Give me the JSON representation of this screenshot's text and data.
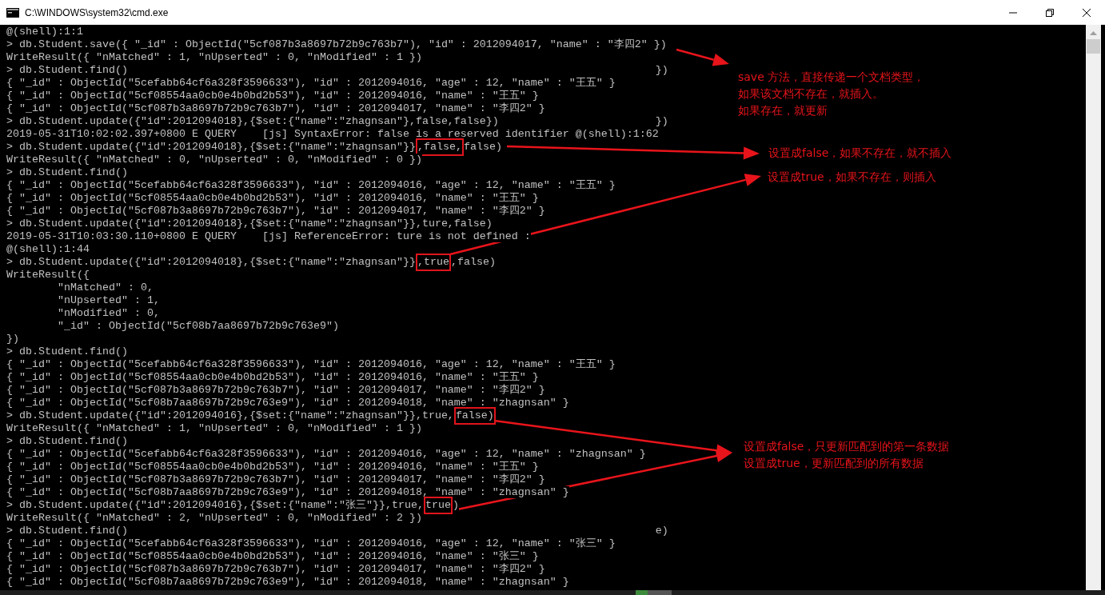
{
  "window": {
    "title": "C:\\WINDOWS\\system32\\cmd.exe"
  },
  "console": {
    "lines": [
      {
        "text": "@(shell):1:1"
      },
      {
        "text": "> db.Student.save({ \"_id\" : ObjectId(\"5cf087b3a8697b72b9c763b7\"), \"id\" : 2012094017, \"name\" : \"李四2\" })"
      },
      {
        "text": "WriteResult({ \"nMatched\" : 1, \"nUpserted\" : 0, \"nModified\" : 1 })"
      },
      {
        "text": "> db.Student.find()",
        "tail": "})"
      },
      {
        "text": "{ \"_id\" : ObjectId(\"5cefabb64cf6a328f3596633\"), \"id\" : 2012094016, \"age\" : 12, \"name\" : \"王五\" }"
      },
      {
        "text": "{ \"_id\" : ObjectId(\"5cf08554aa0cb0e4b0bd2b53\"), \"id\" : 2012094016, \"name\" : \"王五\" }"
      },
      {
        "text": "{ \"_id\" : ObjectId(\"5cf087b3a8697b72b9c763b7\"), \"id\" : 2012094017, \"name\" : \"李四2\" }"
      },
      {
        "text": "> db.Student.update({\"id\":2012094018},{$set:{\"name\":\"zhagnsan\"},false,false})",
        "tail": "})"
      },
      {
        "text": "2019-05-31T10:02:02.397+0800 E QUERY    [js] SyntaxError: false is a reserved identifier @(shell):1:62"
      },
      {
        "parts": [
          {
            "text": "> db.Student.update({\"id\":2012094018},{$set:{\"name\":\"zhagnsan\"}}",
            "boxed": false
          },
          {
            "text": ",false,",
            "boxed": true
          },
          {
            "text": "false)",
            "boxed": false
          }
        ]
      },
      {
        "text": "WriteResult({ \"nMatched\" : 0, \"nUpserted\" : 0, \"nModified\" : 0 })"
      },
      {
        "text": "> db.Student.find()"
      },
      {
        "text": "{ \"_id\" : ObjectId(\"5cefabb64cf6a328f3596633\"), \"id\" : 2012094016, \"age\" : 12, \"name\" : \"王五\" }"
      },
      {
        "text": "{ \"_id\" : ObjectId(\"5cf08554aa0cb0e4b0bd2b53\"), \"id\" : 2012094016, \"name\" : \"王五\" }"
      },
      {
        "text": "{ \"_id\" : ObjectId(\"5cf087b3a8697b72b9c763b7\"), \"id\" : 2012094017, \"name\" : \"李四2\" }"
      },
      {
        "text": "> db.Student.update({\"id\":2012094018},{$set:{\"name\":\"zhagnsan\"}},ture,false)"
      },
      {
        "text": "2019-05-31T10:03:30.110+0800 E QUERY    [js] ReferenceError: ture is not defined :"
      },
      {
        "text": "@(shell):1:44"
      },
      {
        "parts": [
          {
            "text": "> db.Student.update({\"id\":2012094018},{$set:{\"name\":\"zhagnsan\"}}",
            "boxed": false
          },
          {
            "text": ",true",
            "boxed": true
          },
          {
            "text": ",false)",
            "boxed": false
          }
        ]
      },
      {
        "text": "WriteResult({"
      },
      {
        "text": "        \"nMatched\" : 0,"
      },
      {
        "text": "        \"nUpserted\" : 1,"
      },
      {
        "text": "        \"nModified\" : 0,"
      },
      {
        "text": "        \"_id\" : ObjectId(\"5cf08b7aa8697b72b9c763e9\")"
      },
      {
        "text": "})"
      },
      {
        "text": "> db.Student.find()"
      },
      {
        "text": "{ \"_id\" : ObjectId(\"5cefabb64cf6a328f3596633\"), \"id\" : 2012094016, \"age\" : 12, \"name\" : \"王五\" }"
      },
      {
        "text": "{ \"_id\" : ObjectId(\"5cf08554aa0cb0e4b0bd2b53\"), \"id\" : 2012094016, \"name\" : \"王五\" }"
      },
      {
        "text": "{ \"_id\" : ObjectId(\"5cf087b3a8697b72b9c763b7\"), \"id\" : 2012094017, \"name\" : \"李四2\" }"
      },
      {
        "text": "{ \"_id\" : ObjectId(\"5cf08b7aa8697b72b9c763e9\"), \"id\" : 2012094018, \"name\" : \"zhagnsan\" }"
      },
      {
        "parts": [
          {
            "text": "> db.Student.update({\"id\":2012094016},{$set:{\"name\":\"zhagnsan\"}},true,",
            "boxed": false
          },
          {
            "text": "false)",
            "boxed": true
          }
        ]
      },
      {
        "text": "WriteResult({ \"nMatched\" : 1, \"nUpserted\" : 0, \"nModified\" : 1 })"
      },
      {
        "text": "> db.Student.find()"
      },
      {
        "text": "{ \"_id\" : ObjectId(\"5cefabb64cf6a328f3596633\"), \"id\" : 2012094016, \"age\" : 12, \"name\" : \"zhagnsan\" }"
      },
      {
        "text": "{ \"_id\" : ObjectId(\"5cf08554aa0cb0e4b0bd2b53\"), \"id\" : 2012094016, \"name\" : \"王五\" }"
      },
      {
        "text": "{ \"_id\" : ObjectId(\"5cf087b3a8697b72b9c763b7\"), \"id\" : 2012094017, \"name\" : \"李四2\" }"
      },
      {
        "text": "{ \"_id\" : ObjectId(\"5cf08b7aa8697b72b9c763e9\"), \"id\" : 2012094018, \"name\" : \"zhagnsan\" }"
      },
      {
        "parts": [
          {
            "text": "> db.Student.update({\"id\":2012094016},{$set:{\"name\":\"张三\"}},true,",
            "boxed": false
          },
          {
            "text": "true",
            "boxed": true
          },
          {
            "text": ")",
            "boxed": false
          }
        ]
      },
      {
        "text": "WriteResult({ \"nMatched\" : 2, \"nUpserted\" : 0, \"nModified\" : 2 })"
      },
      {
        "text": "> db.Student.find()",
        "tail": "e)"
      },
      {
        "text": "{ \"_id\" : ObjectId(\"5cefabb64cf6a328f3596633\"), \"id\" : 2012094016, \"age\" : 12, \"name\" : \"张三\" }"
      },
      {
        "text": "{ \"_id\" : ObjectId(\"5cf08554aa0cb0e4b0bd2b53\"), \"id\" : 2012094016, \"name\" : \"张三\" }"
      },
      {
        "text": "{ \"_id\" : ObjectId(\"5cf087b3a8697b72b9c763b7\"), \"id\" : 2012094017, \"name\" : \"李四2\" }"
      },
      {
        "text": "{ \"_id\" : ObjectId(\"5cf08b7aa8697b72b9c763e9\"), \"id\" : 2012094018, \"name\" : \"zhagnsan\" }"
      }
    ]
  },
  "notes": [
    {
      "lines": [
        "save 方法，直接传递一个文档类型，",
        "如果该文档不存在，就插入。",
        "如果存在，就更新"
      ]
    },
    {
      "lines": [
        "设置成false，如果不存在，就不插入"
      ]
    },
    {
      "lines": [
        "设置成true，如果不存在，则插入"
      ]
    },
    {
      "lines": [
        "设置成false，只更新匹配到的第一条数据",
        "设置成true，更新匹配到的所有数据"
      ]
    }
  ]
}
